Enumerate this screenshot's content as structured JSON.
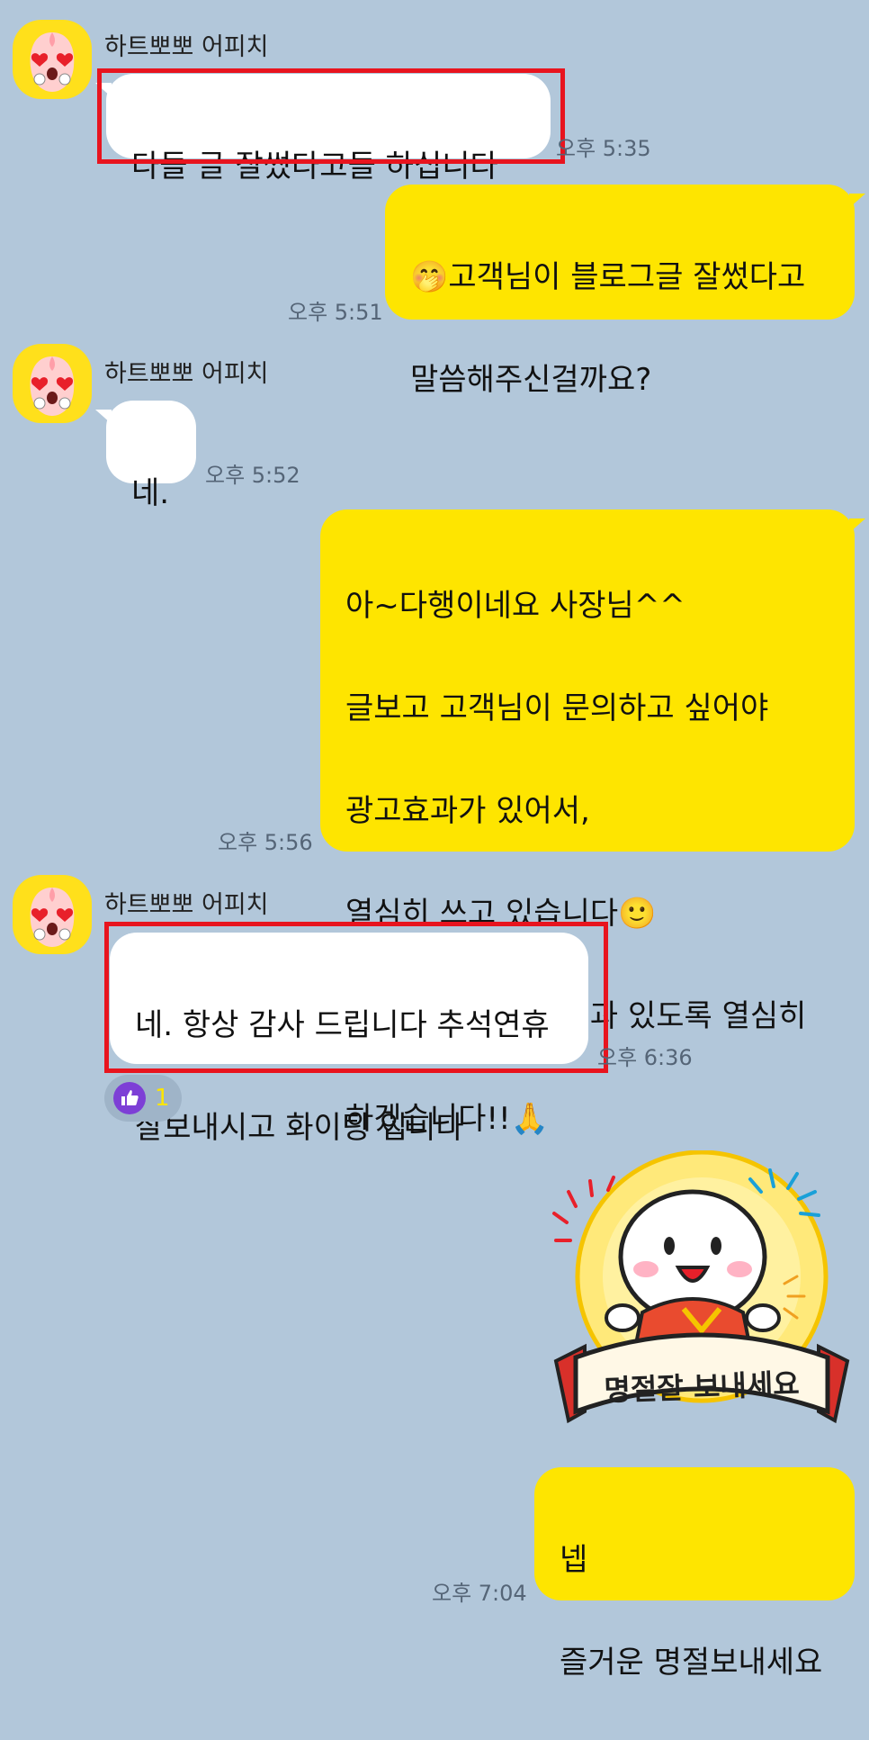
{
  "messages": [
    {
      "sender": "하트뽀뽀 어피치",
      "text": "다들  글 잘썼다고들  하십니다",
      "time": "오후 5:35"
    },
    {
      "text_emoji": "🤭",
      "text_line1": "고객님이 블로그글 잘썼다고",
      "text_line2": "말씀해주신걸까요?",
      "time": "오후 5:51"
    },
    {
      "sender": "하트뽀뽀 어피치",
      "text": "네.",
      "time": "오후 5:52"
    },
    {
      "line1": "아~다행이네요 사장님^^",
      "line2": "글보고 고객님이 문의하고 싶어야",
      "line3": "광고효과가 있어서,",
      "line4": "열심히 쓰고 있습니다",
      "line4_emoji": "🙂",
      "line5": "앞으로 더더 좋은결과 있도록 열심히",
      "line6": "하겠습니다!!",
      "line6_emoji": "🙏",
      "time": "오후 5:56"
    },
    {
      "sender": "하트뽀뽀 어피치",
      "line1": "네. 항상 감사 드립니다 추석연휴",
      "line2": "잘보내시고  화이팅  입니다",
      "time": "오후 6:36",
      "reaction_count": "1"
    },
    {
      "sticker_text": "명절잘 보내세요"
    },
    {
      "line1": "넵",
      "line2": "즐거운 명절보내세요",
      "time": "오후 7:04"
    }
  ],
  "colors": {
    "background": "#b2c7da",
    "outgoing": "#fee500",
    "incoming": "#ffffff",
    "highlight": "#e8141e",
    "reaction": "#7d3fd6"
  },
  "icons": {
    "avatar": "apeach-heart-eyes-icon",
    "reaction": "thumbs-up-icon"
  }
}
